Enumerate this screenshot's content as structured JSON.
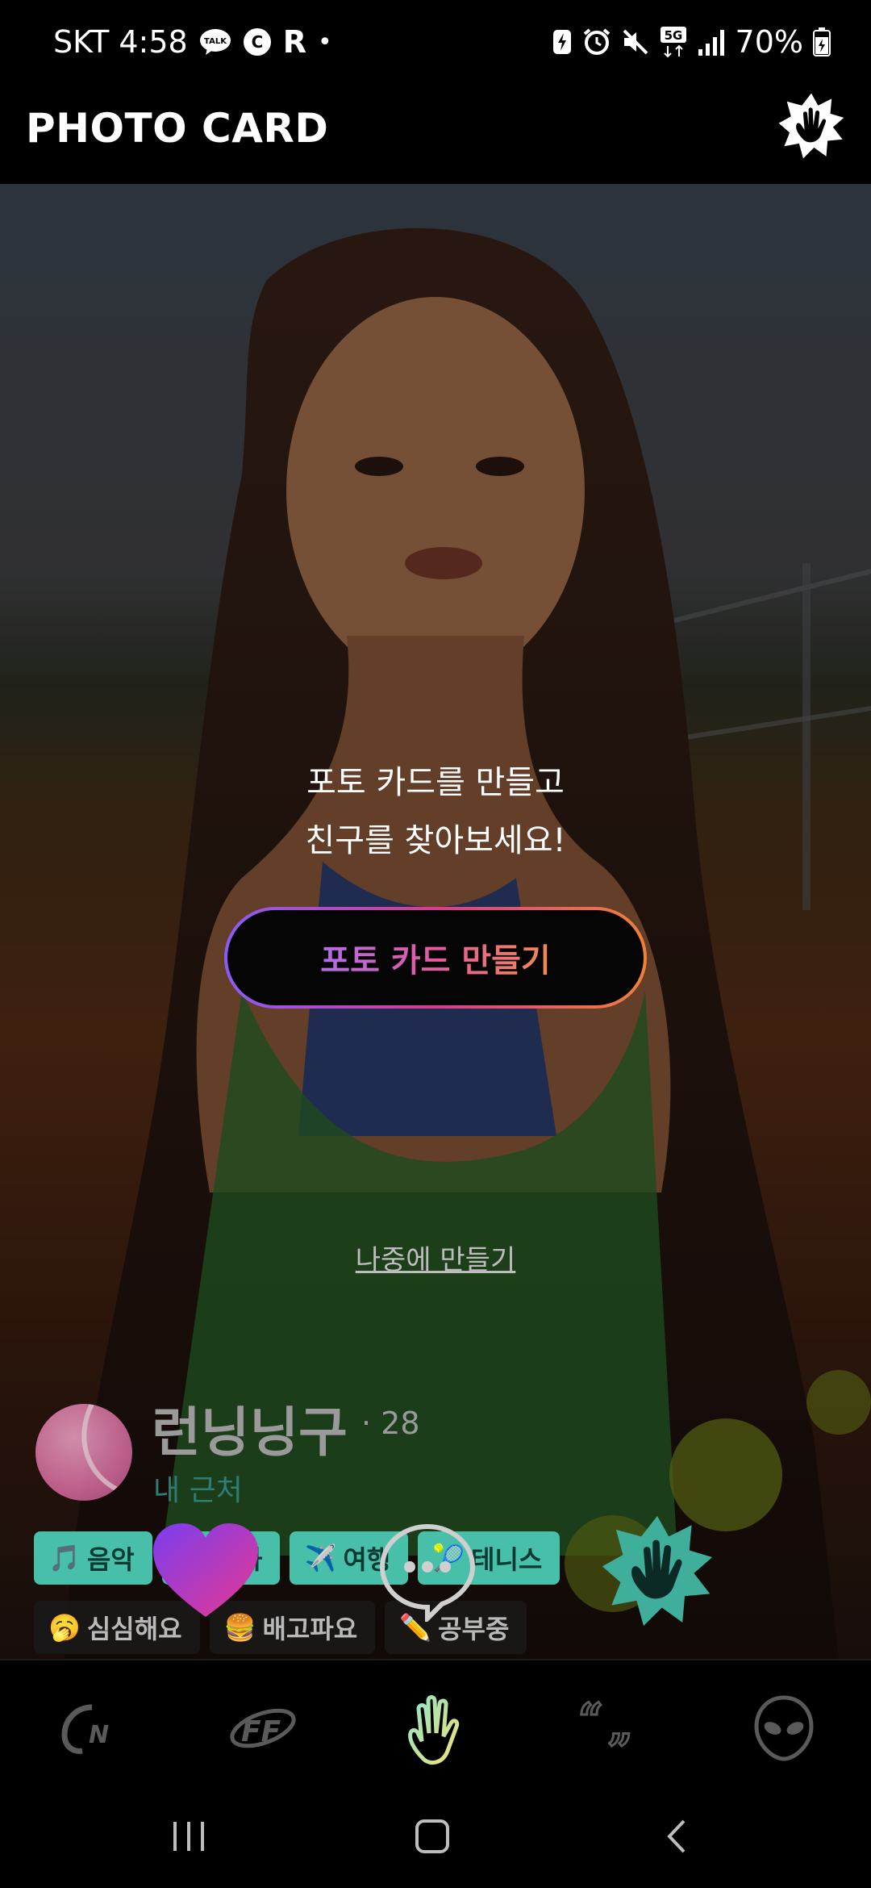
{
  "status_bar": {
    "carrier_time": "SKT 4:58",
    "talk_badge": "TALK",
    "c_badge": "C",
    "r_badge": "R",
    "dot": "•",
    "network": "5G",
    "battery": "70%"
  },
  "header": {
    "title": "PHOTO CARD"
  },
  "cta": {
    "line1": "포토 카드를 만들고",
    "line2": "친구를 찾아보세요!",
    "button_label": "포토 카드 만들기",
    "later_label": "나중에 만들기"
  },
  "profile": {
    "name": "런닝닝구",
    "age": "· 28",
    "location": "내 근처"
  },
  "interest_tags": [
    {
      "emoji": "🎵",
      "label": "음악"
    },
    {
      "emoji": "🎬",
      "label": "영화"
    },
    {
      "emoji": "✈️",
      "label": "여행"
    },
    {
      "emoji": "🎾",
      "label": "테니스"
    }
  ],
  "mood_tags": [
    {
      "emoji": "🥱",
      "label": "심심해요"
    },
    {
      "emoji": "🍔",
      "label": "배고파요"
    },
    {
      "emoji": "✏️",
      "label": "공부중"
    }
  ],
  "colors": {
    "accent_teal": "#47bfa9",
    "heart_gradient": [
      "#7a3df0",
      "#e8388f"
    ],
    "button_gradient": [
      "#8a5cf6",
      "#d63d8f",
      "#f0803a"
    ]
  },
  "nav": {
    "items": [
      "cn-logo-icon",
      "ff-logo-icon",
      "wave-hand-icon",
      "quote-icon",
      "alien-icon"
    ],
    "active": "wave-hand-icon"
  }
}
